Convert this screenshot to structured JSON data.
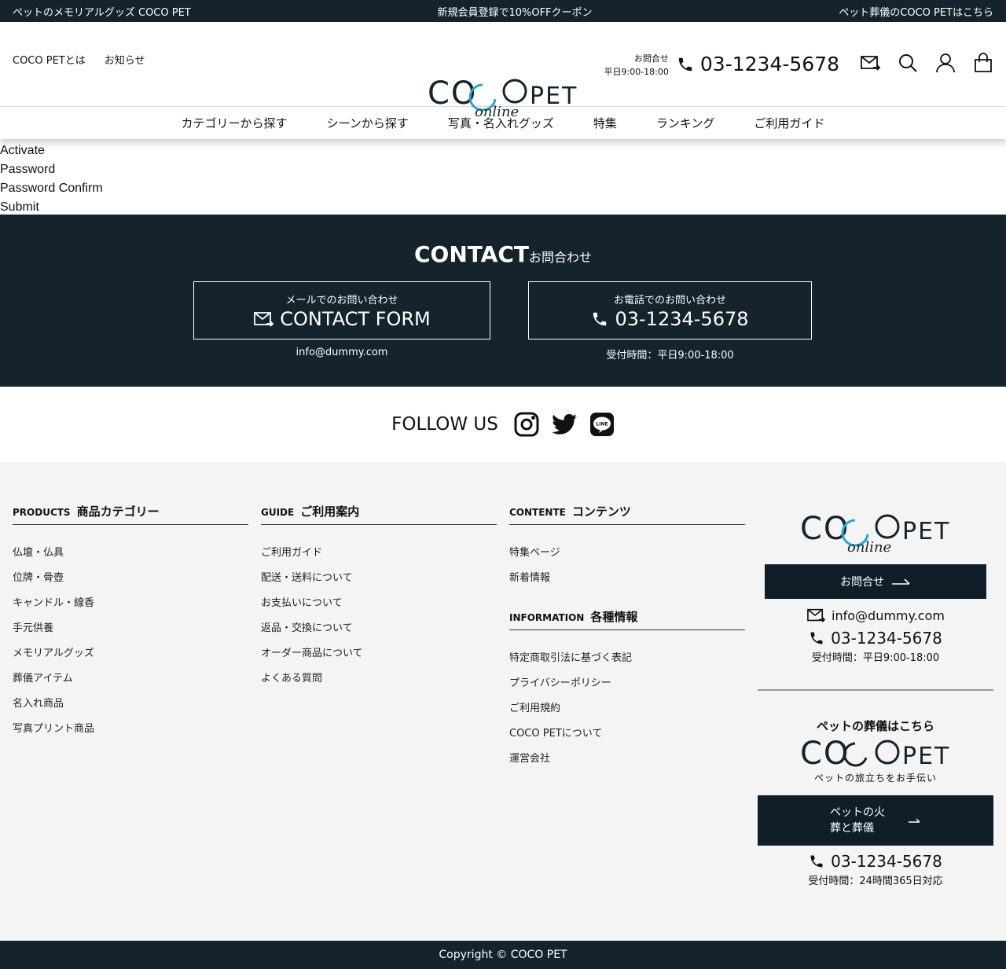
{
  "topbar": {
    "left": "ペットのメモリアルグッズ COCO PET",
    "center": "新規会員登録で10%OFFクーポン",
    "right": "ペット葬儀のCOCO PETはこちら"
  },
  "header": {
    "nav": [
      "COCO PETとは",
      "お知らせ"
    ],
    "hours_label": "お問合せ",
    "hours": "平日9:00-18:00",
    "phone": "03-1234-5678"
  },
  "logo": {
    "main_left": "COC",
    "main_right": "PET",
    "sub": "online"
  },
  "catnav": [
    "カテゴリーから探す",
    "シーンから探す",
    "写真・名入れグッズ",
    "特集",
    "ランキング",
    "ご利用ガイド"
  ],
  "form": {
    "activate": "Activate",
    "password": "Password",
    "confirm": "Password Confirm",
    "submit": "Submit"
  },
  "contact": {
    "title": "CONTACT",
    "title_ja": "お問合わせ",
    "mail_sub": "メールでのお問い合わせ",
    "mail_main": "CONTACT FORM",
    "mail_note": "info@dummy.com",
    "tel_sub": "お電話でのお問い合わせ",
    "tel_main": "03-1234-5678",
    "tel_note": "受付時間：平日9:00-18:00"
  },
  "follow": {
    "label": "FOLLOW US"
  },
  "footer": {
    "products": {
      "en": "PRODUCTS",
      "ja": "商品カテゴリー",
      "items": [
        "仏壇・仏具",
        "位牌・骨壺",
        "キャンドル・線香",
        "手元供養",
        "メモリアルグッズ",
        "葬儀アイテム",
        "名入れ商品",
        "写真プリント商品"
      ]
    },
    "guide": {
      "en": "GUIDE",
      "ja": "ご利用案内",
      "items": [
        "ご利用ガイド",
        "配送・送料について",
        "お支払いについて",
        "返品・交換について",
        "オーダー商品について",
        "よくある質問"
      ]
    },
    "contents": {
      "en": "CONTENTE",
      "ja": "コンテンツ",
      "items": [
        "特集ページ",
        "新着情報"
      ]
    },
    "information": {
      "en": "INFORMATION",
      "ja": "各種情報",
      "items": [
        "特定商取引法に基づく表記",
        "プライバシーポリシー",
        "ご利用規約",
        "COCO PETについて",
        "運営会社"
      ]
    },
    "side": {
      "contact_btn": "お問合せ",
      "email": "info@dummy.com",
      "phone": "03-1234-5678",
      "hours": "受付時間：平日9:00-18:00",
      "funeral_head": "ペットの葬儀はこちら",
      "funeral_tag": "ペットの旅立ちをお手伝い",
      "funeral_btn_1": "ペットの火",
      "funeral_btn_2": "葬と葬儀",
      "phone2": "03-1234-5678",
      "hours2": "受付時間：24時間365日対応"
    }
  },
  "copyright": "Copyright © COCO PET"
}
